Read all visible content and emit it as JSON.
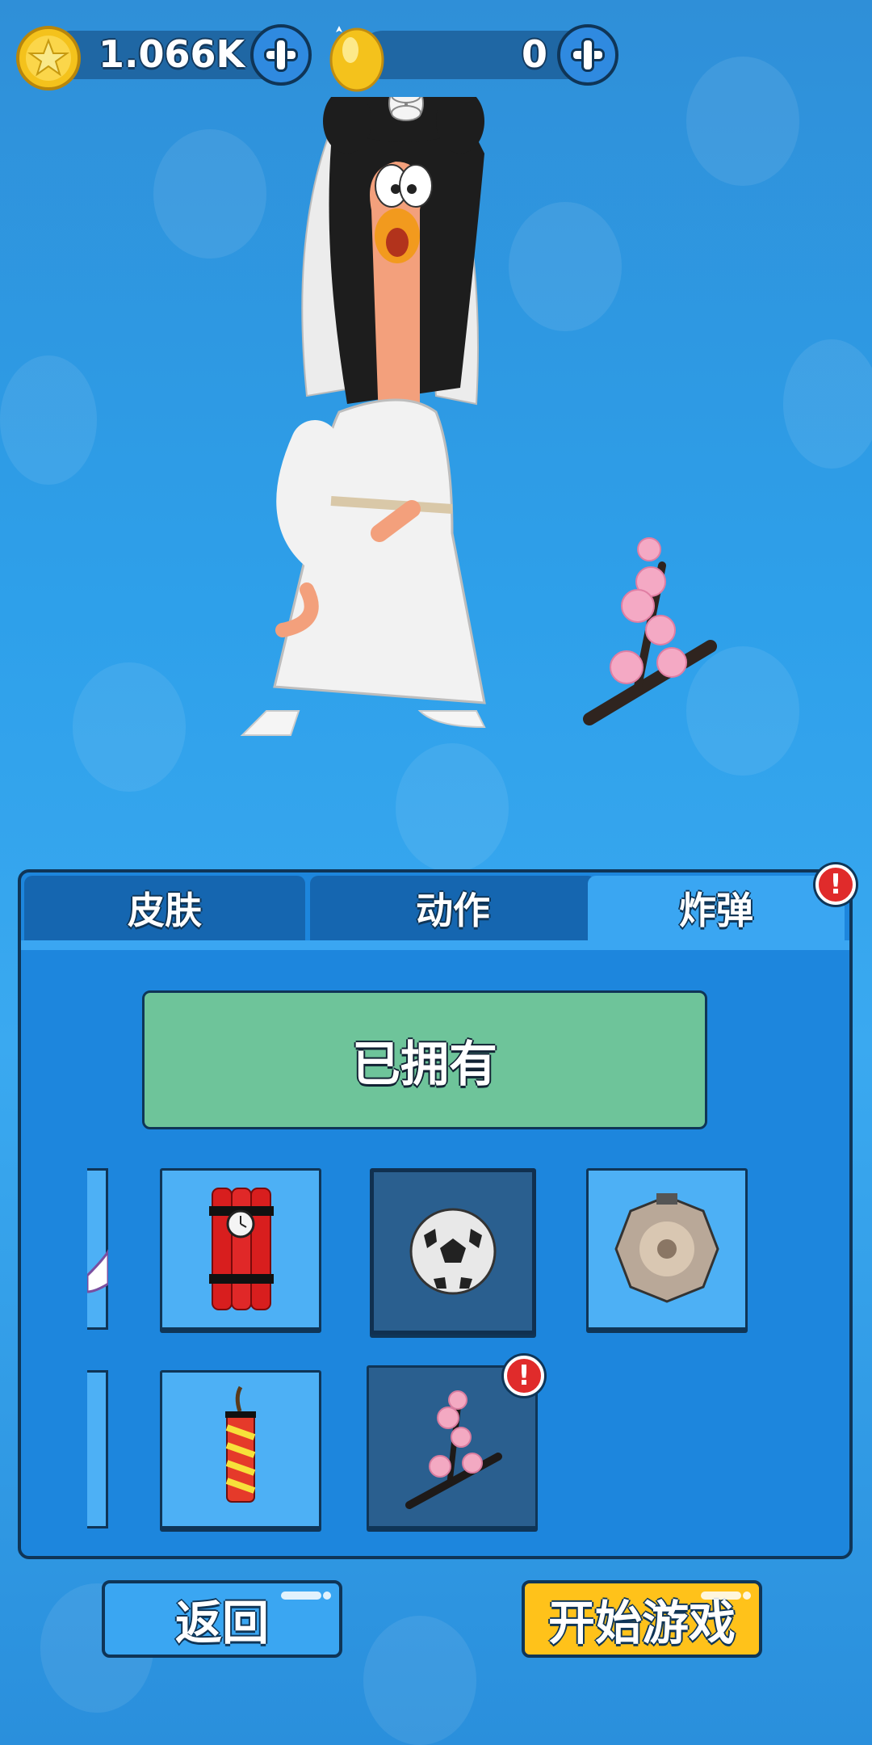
{
  "currency": {
    "coins": "1.066K",
    "eggs": "0"
  },
  "tabs": [
    {
      "label": "皮肤",
      "active": false
    },
    {
      "label": "动作",
      "active": false
    },
    {
      "label": "炸弹",
      "active": true,
      "alert": "!"
    }
  ],
  "owned_label": "已拥有",
  "items": [
    {
      "name": "dynamite-bundle",
      "state": "normal"
    },
    {
      "name": "soccer-ball",
      "state": "selected"
    },
    {
      "name": "gong",
      "state": "normal"
    },
    {
      "name": "firecracker",
      "state": "normal"
    },
    {
      "name": "cherry-blossom-branch",
      "state": "owned",
      "alert": "!"
    }
  ],
  "buttons": {
    "back": "返回",
    "start": "开始游戏"
  },
  "colors": {
    "background": "#2ea0ea",
    "panel": "#1d86dd",
    "owned_green": "#6ec49a",
    "start_yellow": "#ffc21a",
    "alert_red": "#e02b2b"
  }
}
